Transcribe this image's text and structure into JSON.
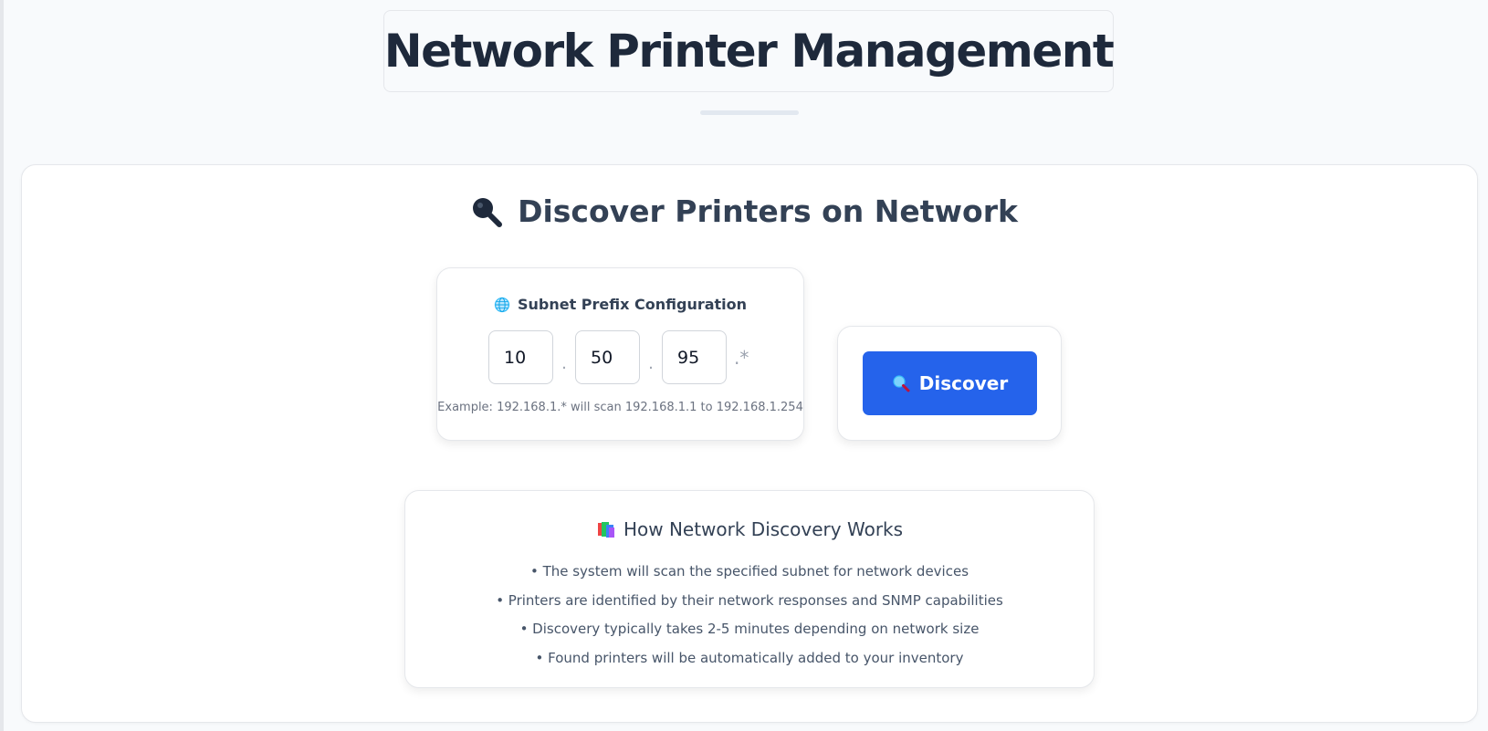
{
  "header": {
    "title": "Network Printer Management"
  },
  "discover_section": {
    "title": "Discover Printers on Network",
    "title_icon": "magnifier-icon"
  },
  "subnet": {
    "heading": "Subnet Prefix Configuration",
    "heading_icon": "globe-icon",
    "octets": [
      "10",
      "50",
      "95"
    ],
    "separator": ".",
    "wildcard": ".*",
    "example": "Example: 192.168.1.* will scan 192.168.1.1 to 192.168.1.254"
  },
  "discover_button": {
    "label": "Discover",
    "icon": "magnifier-icon",
    "color": "#2563eb"
  },
  "info": {
    "heading": "How Network Discovery Works",
    "heading_icon": "books-icon",
    "items": [
      "• The system will scan the specified subnet for network devices",
      "• Printers are identified by their network responses and SNMP capabilities",
      "• Discovery typically takes 2-5 minutes depending on network size",
      "• Found printers will be automatically added to your inventory"
    ]
  }
}
